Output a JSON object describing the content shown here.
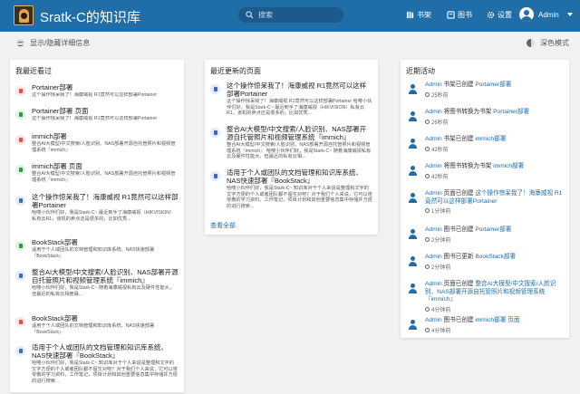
{
  "header": {
    "site_title": "Sratk-C的知识库",
    "search_placeholder": "搜索",
    "nav": [
      {
        "label": "书架",
        "icon": "bookshelf-icon"
      },
      {
        "label": "图书",
        "icon": "book-icon"
      },
      {
        "label": "设置",
        "icon": "gear-icon"
      }
    ],
    "user_name": "Admin"
  },
  "toolbar": {
    "toggle_details": "显示/隐藏详细信息",
    "dark_mode": "深色模式"
  },
  "recently_viewed": {
    "title": "我最近看过",
    "items": [
      {
        "title": "Portainer部署",
        "desc": "这个操作惊呆我了！海康威视 R1竟然可以这样部署Portainer",
        "color": "red"
      },
      {
        "title": "Portainer部署 页面",
        "desc": "这个操作惊呆我了！海康威视 R1竟然可以这样部署Portainer",
        "color": "green"
      },
      {
        "title": "immich部署",
        "desc": "整合AI大模型/中文搜索/人脸识别、NAS部署开源自托管照片和视频管理系统『immich』",
        "color": "red"
      },
      {
        "title": "immich部署 页面",
        "desc": "整合AI大模型/中文搜索/人脸识别、NAS部署开源自托管照片和视频管理系统『immich』",
        "color": "green"
      },
      {
        "title": "这个操作惊呆我了！海康威视 R1竟然可以这样部署Portainer",
        "desc": "哈喽小伙伴们好，我是Stark-C~ 最近到手了海康威视（HIKVISION）私有云R1，该机的卖点还是很多的，比如优秀...",
        "color": "blue"
      },
      {
        "title": "BookStack部署",
        "desc": "适用于个人或团队的文档管理和知识库系统、NAS快速部署『BookStack』",
        "color": "green"
      },
      {
        "title": "整合AI大模型/中文搜索/人脸识别、NAS部署开源自托管照片和视频管理系统『immich』",
        "desc": "哈喽小伙伴们好，我是Stark-C~ 随着海康威视私有云及硬件性能大，但最近的私有云相册最...",
        "color": "blue"
      },
      {
        "title": "BookStack部署",
        "desc": "适用于个人或团队的文档管理和知识库系统、NAS快速部署『BookStack』",
        "color": "red"
      },
      {
        "title": "适用于个人或团队的文档管理和知识库系统、NAS快速部署『BookStack』",
        "desc": "哈喽小伙伴们好，我是Stark-C~ 知识库对于个人来说是整理和文字的文字方便的个人或者团队都不留生对吧？对于我们个人来说，它可以将零散的学习资料，工作笔记，项目计划和其他重要信息集中存储并方便的进行搜索...",
        "color": "blue"
      }
    ]
  },
  "recently_updated": {
    "title": "最近更新的页面",
    "items": [
      {
        "title": "这个操作惊呆我了！海康威视 R1竟然可以这样部署Portainer",
        "desc": "这个操作惊呆我了！海康威视 R1竟然可以这样部署Portainer 哈喽小伙伴们好，我是Stark-C~ 最近到手了海康威视（HIKVISION）私有云R1，该机的卖点还是很多的，比如优秀...",
        "color": "blue"
      },
      {
        "title": "整合AI大模型/中文搜索/人脸识别、NAS部署开源自托管照片和视频管理系统『immich』",
        "desc": "整合AI大模型/中文搜索/人脸识别、NAS部署开源自托管照片和视频管理系统『immich』 哈喽小伙伴们好，我是Stark-C~ 随着海康威视私有云及硬件性能大，但最近的私有云相...",
        "color": "blue"
      },
      {
        "title": "适用于个人或团队的文档管理和知识库系统、NAS快速部署『BookStack』",
        "desc": "哈喽小伙伴们好，我是Stark-C~ 知识库对于个人来说是整理和文字的文字方便的个人或者团队都不留生对吧？对于我们个人来说，它可以将零散的学习资料，工作笔记，项目计划和其他重要信息集中存储并方便的进行搜索...",
        "color": "blue"
      }
    ],
    "view_all": "查看全部"
  },
  "activity": {
    "title": "近期活动",
    "items": [
      {
        "user": "Admin",
        "action": " 书架已创建 ",
        "target": "Portainer部署",
        "time": "25秒前"
      },
      {
        "user": "Admin",
        "action": " 将图书转换为书架 ",
        "target": "Portainer部署",
        "time": "26秒前"
      },
      {
        "user": "Admin",
        "action": " 书架已创建 ",
        "target": "immich部署",
        "time": "42秒前"
      },
      {
        "user": "Admin",
        "action": " 将图书转换为书架 ",
        "target": "immich部署",
        "time": "42秒前"
      },
      {
        "user": "Admin",
        "action": " 页面已创建 ",
        "target": "这个操作惊呆我了！海康威视 R1竟然可以这样部署Portainer",
        "time": "1分钟前"
      },
      {
        "user": "Admin",
        "action": " 图书已创建 ",
        "target": "Portainer部署",
        "time": "2分钟前"
      },
      {
        "user": "Admin",
        "action": " 图书已更新 ",
        "target": "BookStack部署",
        "time": "2分钟前"
      },
      {
        "user": "Admin",
        "action": " 页面已创建 ",
        "target": "整合AI大模型/中文搜索/人脸识别、NAS部署开源自托管照片和视频管理系统『immich』",
        "time": "4分钟前"
      },
      {
        "user": "Admin",
        "action": " 图书已创建 ",
        "target": "immich部署 页面",
        "time": "4分钟前"
      }
    ]
  },
  "colors": {
    "header_bg": "#206ea7",
    "accent": "#206ea7",
    "page_bg": "#f2f2f2"
  }
}
